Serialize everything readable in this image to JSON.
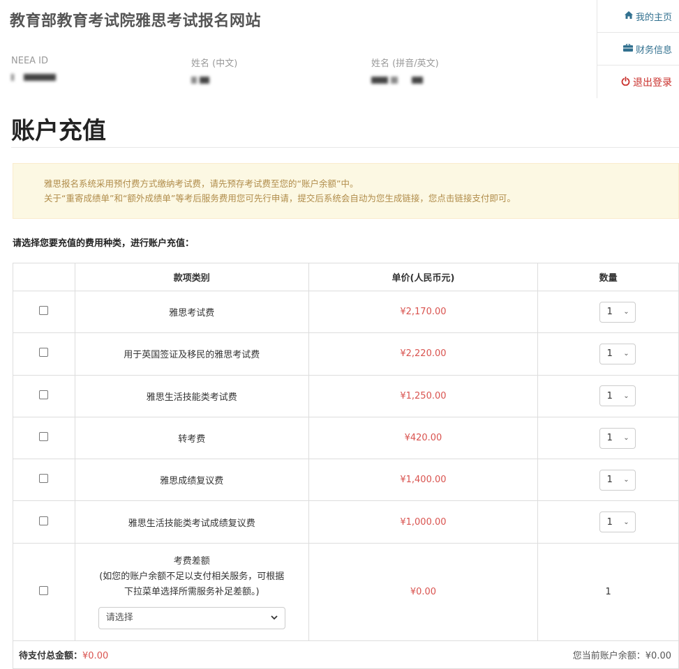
{
  "header": {
    "title": "教育部教育考试院雅思考试报名网站",
    "fields": [
      {
        "label": "NEEA ID"
      },
      {
        "label": "姓名 (中文)"
      },
      {
        "label": "姓名 (拼音/英文)"
      }
    ]
  },
  "nav": [
    {
      "label": "我的主页",
      "icon": "home-icon"
    },
    {
      "label": "财务信息",
      "icon": "briefcase-icon"
    },
    {
      "label": "退出登录",
      "icon": "power-icon"
    }
  ],
  "page": {
    "title": "账户充值",
    "notice": [
      "雅思报名系统采用预付费方式缴纳考试费，请先预存考试费至您的“账户余额”中。",
      "关于“重寄成绩单”和“额外成绩单”等考后服务费用您可先行申请，提交后系统会自动为您生成链接，您点击链接支付即可。"
    ],
    "instruction": "请选择您要充值的费用种类，进行账户充值："
  },
  "table": {
    "headers": [
      "",
      "款项类别",
      "单价(人民币元)",
      "数量"
    ],
    "rows": [
      {
        "name": "雅思考试费",
        "price": "¥2,170.00",
        "qty": "1"
      },
      {
        "name": "用于英国签证及移民的雅思考试费",
        "price": "¥2,220.00",
        "qty": "1"
      },
      {
        "name": "雅思生活技能类考试费",
        "price": "¥1,250.00",
        "qty": "1"
      },
      {
        "name": "转考费",
        "price": "¥420.00",
        "qty": "1"
      },
      {
        "name": "雅思成绩复议费",
        "price": "¥1,400.00",
        "qty": "1"
      },
      {
        "name": "雅思生活技能类考试成绩复议费",
        "price": "¥1,000.00",
        "qty": "1"
      }
    ],
    "diff": {
      "name": "考费差额",
      "desc1": "(如您的账户余额不足以支付相关服务，可根据",
      "desc2": "下拉菜单选择所需服务补足差额。)",
      "select_placeholder": "请选择",
      "price": "¥0.00",
      "qty": "1"
    },
    "footer": {
      "total_label": "待支付总金额：",
      "total_value": "¥0.00",
      "balance_label": "您当前账户余额：",
      "balance_value": "¥0.00"
    }
  },
  "colors": {
    "price": "#d9534f",
    "nav_link": "#31708f",
    "logout": "#c9302c",
    "notice_bg": "#fcf8e3"
  }
}
